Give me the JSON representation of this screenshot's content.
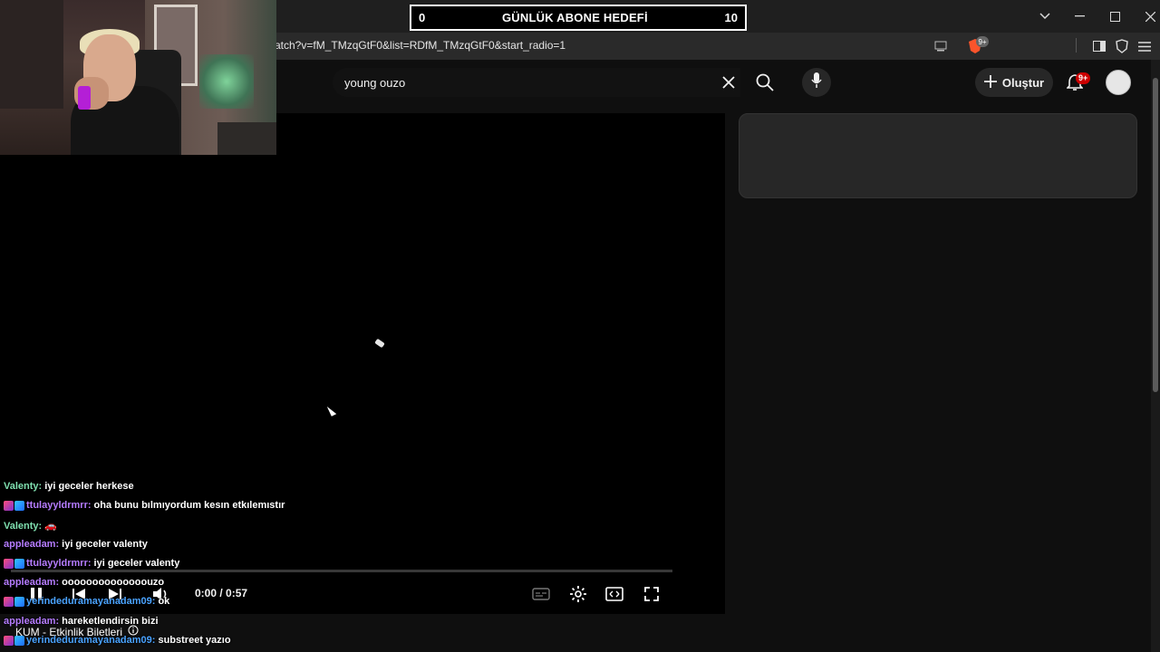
{
  "browser": {
    "url": "atch?v=fM_TMzqGtF0&list=RDfM_TMzqGtF0&start_radio=1",
    "window_controls": [
      "chevron-down",
      "minimize",
      "maximize",
      "close"
    ]
  },
  "goal": {
    "left": "0",
    "title": "GÜNLÜK ABONE HEDEFİ",
    "right": "10"
  },
  "youtube": {
    "search_query": "young ouzo",
    "create_label": "Oluştur",
    "notification_badge": "9+",
    "accent": "#cc0000"
  },
  "player": {
    "time": "0:00 / 0:57",
    "progress_fraction": 0.0,
    "ticket_label": "KUM - Etkinlik Biletleri"
  },
  "chat": [
    {
      "user": "Valenty:",
      "msg": "iyi geceler herkese",
      "color": "#7fe0b0",
      "badges": false
    },
    {
      "user": "ttulayyldrmrr:",
      "msg": "oha bunu bılmıyordum kesın etkılemıstır",
      "color": "#b57cff",
      "badges": true
    },
    {
      "user": "Valenty:",
      "msg": "🚗",
      "color": "#7fe0b0",
      "badges": false
    },
    {
      "user": "appleadam:",
      "msg": "iyi geceler valenty",
      "color": "#b57cff",
      "badges": false
    },
    {
      "user": "ttulayyldrmrr:",
      "msg": "iyi geceler valenty",
      "color": "#b57cff",
      "badges": true
    },
    {
      "user": "appleadam:",
      "msg": "oooooooooooooouzo",
      "color": "#b57cff",
      "badges": false
    },
    {
      "user": "yerindeduramayanadam09:",
      "msg": "ok",
      "color": "#4aa3ff",
      "badges": true
    },
    {
      "user": "appleadam:",
      "msg": "hareketlendirsin bizi",
      "color": "#b57cff",
      "badges": false
    },
    {
      "user": "yerindeduramayanadam09:",
      "msg": "substreet yazıo",
      "color": "#4aa3ff",
      "badges": true
    }
  ]
}
